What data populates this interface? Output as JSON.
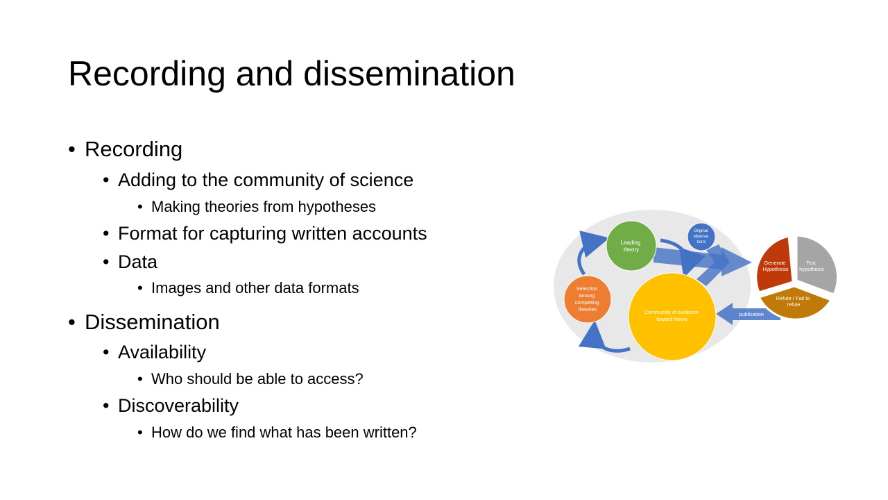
{
  "slide": {
    "title": "Recording and dissemination",
    "bullets": [
      {
        "text": "Recording",
        "level": 1
      },
      {
        "text": "Adding to the community of science",
        "level": 2
      },
      {
        "text": "Making theories from hypotheses",
        "level": 3
      },
      {
        "text": "Format for capturing written accounts",
        "level": 2
      },
      {
        "text": "Data",
        "level": 2
      },
      {
        "text": "Images and other data formats",
        "level": 3
      },
      {
        "text": "Dissemination",
        "level": 1
      },
      {
        "text": "Availability",
        "level": 2
      },
      {
        "text": "Who should be able to access?",
        "level": 3
      },
      {
        "text": "Discoverability",
        "level": 2
      },
      {
        "text": "How do we find what has been written?",
        "level": 3
      }
    ]
  },
  "diagram": {
    "leading_theory": [
      "Leading",
      "theory"
    ],
    "original_observations": [
      "Original",
      "observa",
      "tions"
    ],
    "selection": [
      "Selection",
      "among",
      "competing",
      "theories"
    ],
    "community": [
      "Community of evidence",
      "toward theory"
    ],
    "generate_hypothesis": [
      "Generate",
      "Hypothesis"
    ],
    "test_hypothesis": [
      "Test",
      "hypothesis"
    ],
    "refute": [
      "Refute / Fail to",
      "refute"
    ],
    "publication": "publication"
  },
  "colors": {
    "background_ellipse": "#e8e8e8",
    "leading_theory": "#70ad47",
    "original_observations": "#4472c4",
    "selection": "#ed7d31",
    "community": "#ffc000",
    "arrow_blue": "#4472c4",
    "generate": "#c0390b",
    "test": "#a5a5a5",
    "refute": "#c07a08"
  }
}
